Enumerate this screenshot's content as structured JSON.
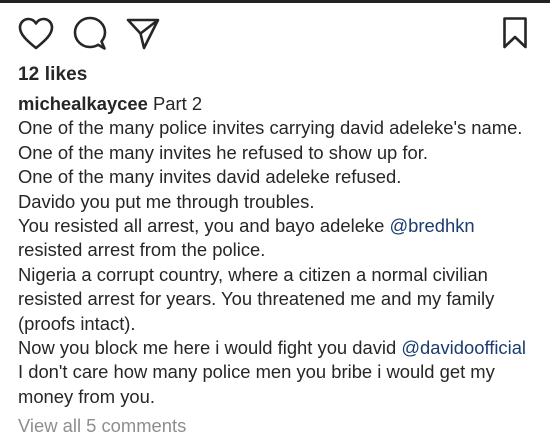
{
  "post": {
    "likes": "12 likes",
    "username": "michealkaycee",
    "caption_lines": {
      "l1_rest": "Part 2",
      "l2": "One of the many police invites carrying david adeleke's name.",
      "l3": "One of the many invites he refused to show up for.",
      "l4": "One of the many invites david adeleke refused.",
      "l5": "Davido you put me through troubles.",
      "l6_pre": "You resisted all arrest, you and bayo adeleke",
      "l6_mention": "@bredhkn",
      "l7": "resisted arrest from the police.",
      "l8": "Nigeria a corrupt country, where a citizen a normal civilian",
      "l9": "resisted arrest for years. You threatened me and my family",
      "l10": "(proofs intact).",
      "l11_pre": "Now you block me here i would fight you david",
      "l11_mention": "@davidoofficial",
      "l12": "I don't care how many police men you bribe i would get my",
      "l13": "money from you."
    },
    "view_comments": "View all 5 comments"
  },
  "icons": {
    "like": "heart-icon",
    "comment": "comment-bubble-icon",
    "share": "paper-plane-icon",
    "save": "bookmark-icon"
  },
  "colors": {
    "text": "#262626",
    "mention": "#1a3c6e",
    "muted": "#8e8e8e",
    "background": "#ffffff"
  }
}
